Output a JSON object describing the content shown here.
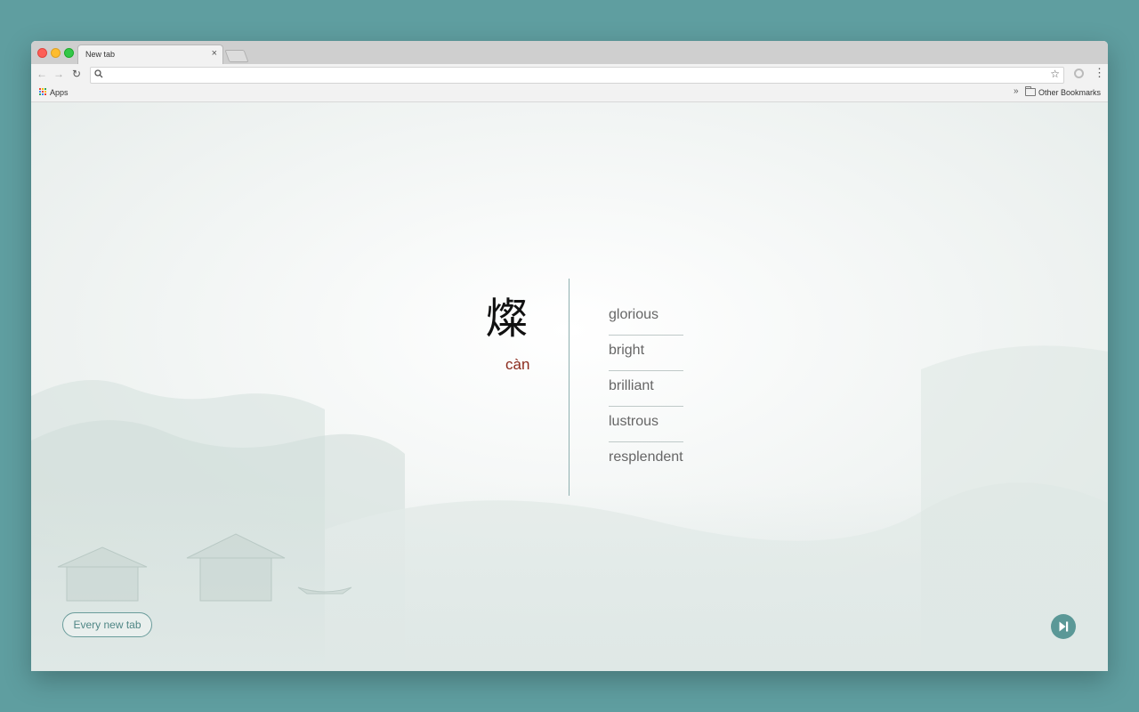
{
  "browser": {
    "tab_title": "New tab",
    "tab_close": "×",
    "bookmarks": {
      "apps_label": "Apps",
      "more_chevron": "»",
      "other_label": "Other Bookmarks"
    },
    "toolbar": {
      "back": "←",
      "forward": "→",
      "reload": "↻",
      "star": "☆",
      "menu": "⋮",
      "omnibox_value": ""
    }
  },
  "card": {
    "character": "燦",
    "pinyin": "càn",
    "meanings": [
      "glorious",
      "bright",
      "brilliant",
      "lustrous",
      "resplendent"
    ]
  },
  "footer": {
    "every_new_tab_label": "Every new tab",
    "next_icon": "skip-next-icon"
  },
  "colors": {
    "desktop": "#5f9ea0",
    "accent": "#5b9897",
    "pinyin": "#8b2a1c"
  }
}
